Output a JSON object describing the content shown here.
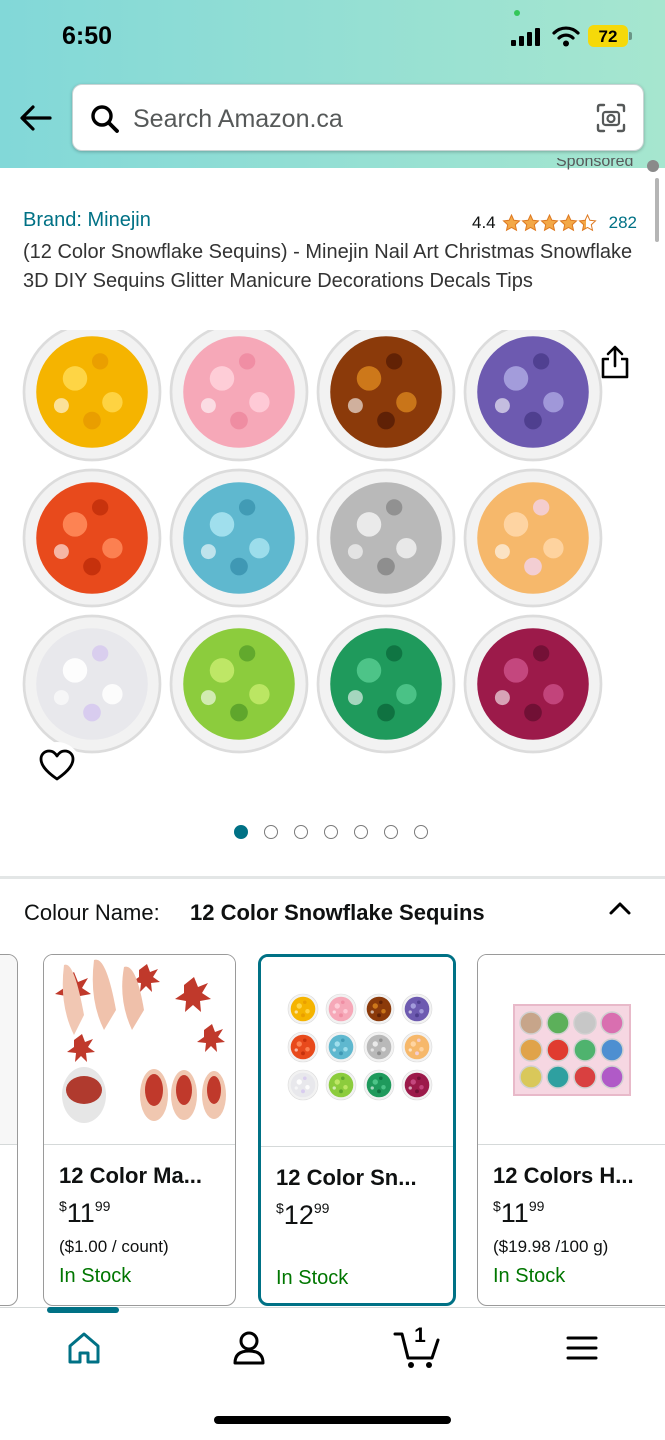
{
  "status_bar": {
    "time": "6:50",
    "battery": "72"
  },
  "search": {
    "placeholder": "Search Amazon.ca"
  },
  "sponsored_label": "Sponsored",
  "product": {
    "brand": "Brand: Minejin",
    "rating": "4.4",
    "stars": 4.4,
    "review_count": "282",
    "title": "(12 Color Snowflake Sequins) - Minejin Nail Art Christmas Snowflake 3D DIY Sequins Glitter Manicure Decorations Decals Tips"
  },
  "image_pager": {
    "total": 7,
    "active": 1
  },
  "variant": {
    "label": "Colour Name:",
    "value": "12 Color Snowflake Sequins"
  },
  "variants": [
    {
      "name": "12 Color Ma...",
      "currency": "$",
      "whole": "11",
      "fraction": "99",
      "unit": "($1.00 / count)",
      "stock": "In Stock"
    },
    {
      "name": "12 Color Sn...",
      "currency": "$",
      "whole": "12",
      "fraction": "99",
      "unit": "",
      "stock": "In Stock"
    },
    {
      "name": "12 Colors H...",
      "currency": "$",
      "whole": "11",
      "fraction": "99",
      "unit": "($19.98 /100 g)",
      "stock": "In Stock"
    }
  ],
  "cart": {
    "count": "1"
  },
  "colors": {
    "accent": "#007185",
    "stock": "#007600",
    "star": "#f3a847"
  },
  "icons": [
    "back-arrow-icon",
    "search-icon",
    "camera-icon",
    "share-icon",
    "heart-icon",
    "chevron-up-icon",
    "home-icon",
    "account-icon",
    "cart-icon",
    "menu-icon"
  ]
}
